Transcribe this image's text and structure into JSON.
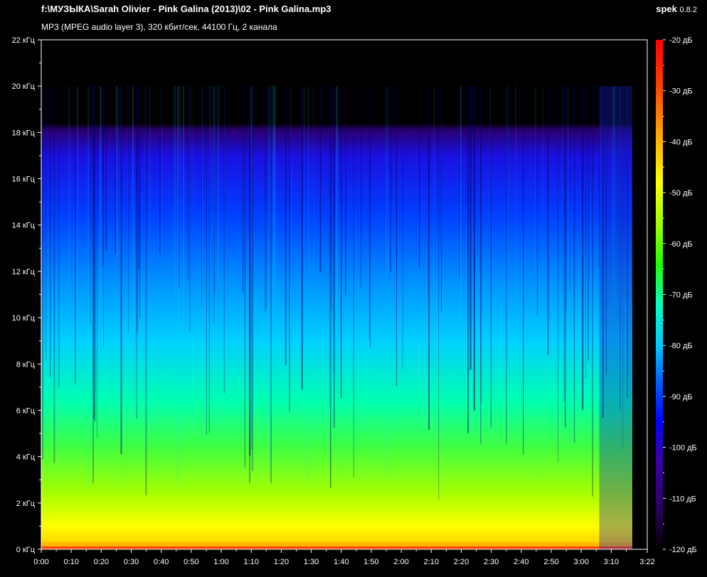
{
  "window": {
    "file_path": "f:\\МУЗЫКА\\Sarah Olivier - Pink Galina (2013)\\02 - Pink Galina.mp3",
    "file_info": "MP3 (MPEG audio layer 3), 320 кбит/сек, 44100 Гц, 2 канала",
    "app_name": "spek",
    "app_version": "0.8.2"
  },
  "chart_data": {
    "type": "heatmap",
    "title": "f:\\МУЗЫКА\\Sarah Olivier - Pink Galina (2013)\\02 - Pink Galina.mp3",
    "xlabel": "",
    "ylabel": "",
    "x_tick_labels": [
      "0:00",
      "0:10",
      "0:20",
      "0:30",
      "0:40",
      "0:50",
      "1:00",
      "1:10",
      "1:20",
      "1:30",
      "1:40",
      "1:50",
      "2:00",
      "2:10",
      "2:20",
      "2:30",
      "2:40",
      "2:50",
      "3:00",
      "3:10",
      "3:22"
    ],
    "x_range_seconds": [
      0,
      202
    ],
    "y_tick_labels": [
      "22 кГц",
      "20 кГц",
      "18 кГц",
      "16 кГц",
      "14 кГц",
      "12 кГц",
      "10 кГц",
      "8 кГц",
      "6 кГц",
      "4 кГц",
      "2 кГц",
      "0 кГц"
    ],
    "y_range_khz": [
      0,
      22
    ],
    "content_cutoff_khz": 20,
    "colorbar_labels": [
      "-20 дБ",
      "-30 дБ",
      "-40 дБ",
      "-50 дБ",
      "-60 дБ",
      "-70 дБ",
      "-80 дБ",
      "-90 дБ",
      "-100 дБ",
      "-110 дБ",
      "-120 дБ"
    ],
    "colorbar_range_db": [
      -120,
      -20
    ],
    "colormap": [
      "#000000",
      "#2a0060",
      "#3a00b0",
      "#0000ff",
      "#0060ff",
      "#00c8ff",
      "#00ffc0",
      "#20ff00",
      "#a0ff00",
      "#ffff00",
      "#ffa000",
      "#ff4000",
      "#ff0000"
    ]
  }
}
